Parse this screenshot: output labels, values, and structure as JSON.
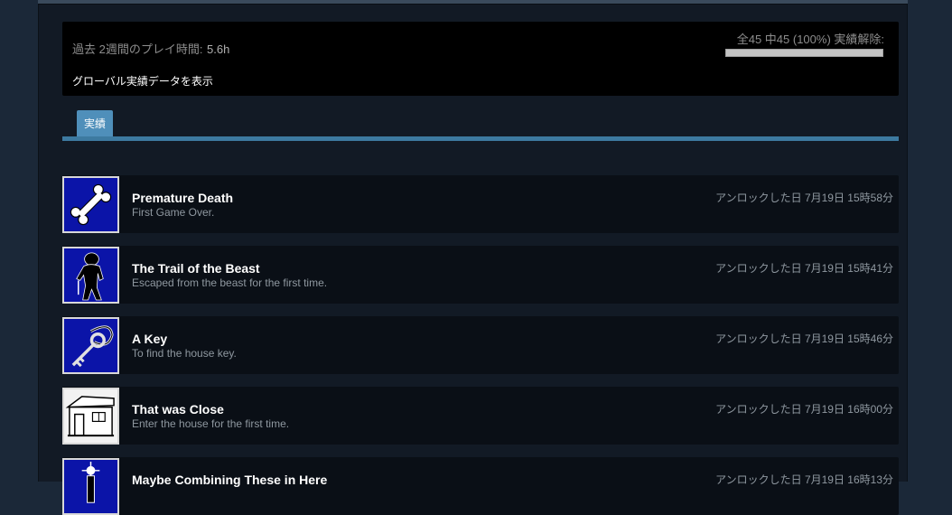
{
  "summary": {
    "playtime_label": "過去 2週間のプレイ時間:",
    "playtime_value": "5.6h",
    "global_link": "グローバル実績データを表示",
    "achievement_count": "全45 中45 (100%) 実績解除:",
    "progress": 1.0
  },
  "tabs": [
    {
      "label": "実績"
    }
  ],
  "achievements": [
    {
      "name": "Premature Death",
      "description": "First Game Over.",
      "unlocked": "アンロックした日 7月19日 15時58分",
      "icon": "bone-icon"
    },
    {
      "name": "The Trail of the Beast",
      "description": "Escaped from the beast for the first time.",
      "unlocked": "アンロックした日 7月19日 15時41分",
      "icon": "beast-silhouette-icon"
    },
    {
      "name": "A Key",
      "description": "To find the house key.",
      "unlocked": "アンロックした日 7月19日 15時46分",
      "icon": "key-icon"
    },
    {
      "name": "That was Close",
      "description": "Enter the house for the first time.",
      "unlocked": "アンロックした日 7月19日 16時00分",
      "icon": "house-icon"
    },
    {
      "name": "Maybe Combining These in Here",
      "description": "",
      "unlocked": "アンロックした日 7月19日 16時13分",
      "icon": "lamp-icon"
    }
  ]
}
